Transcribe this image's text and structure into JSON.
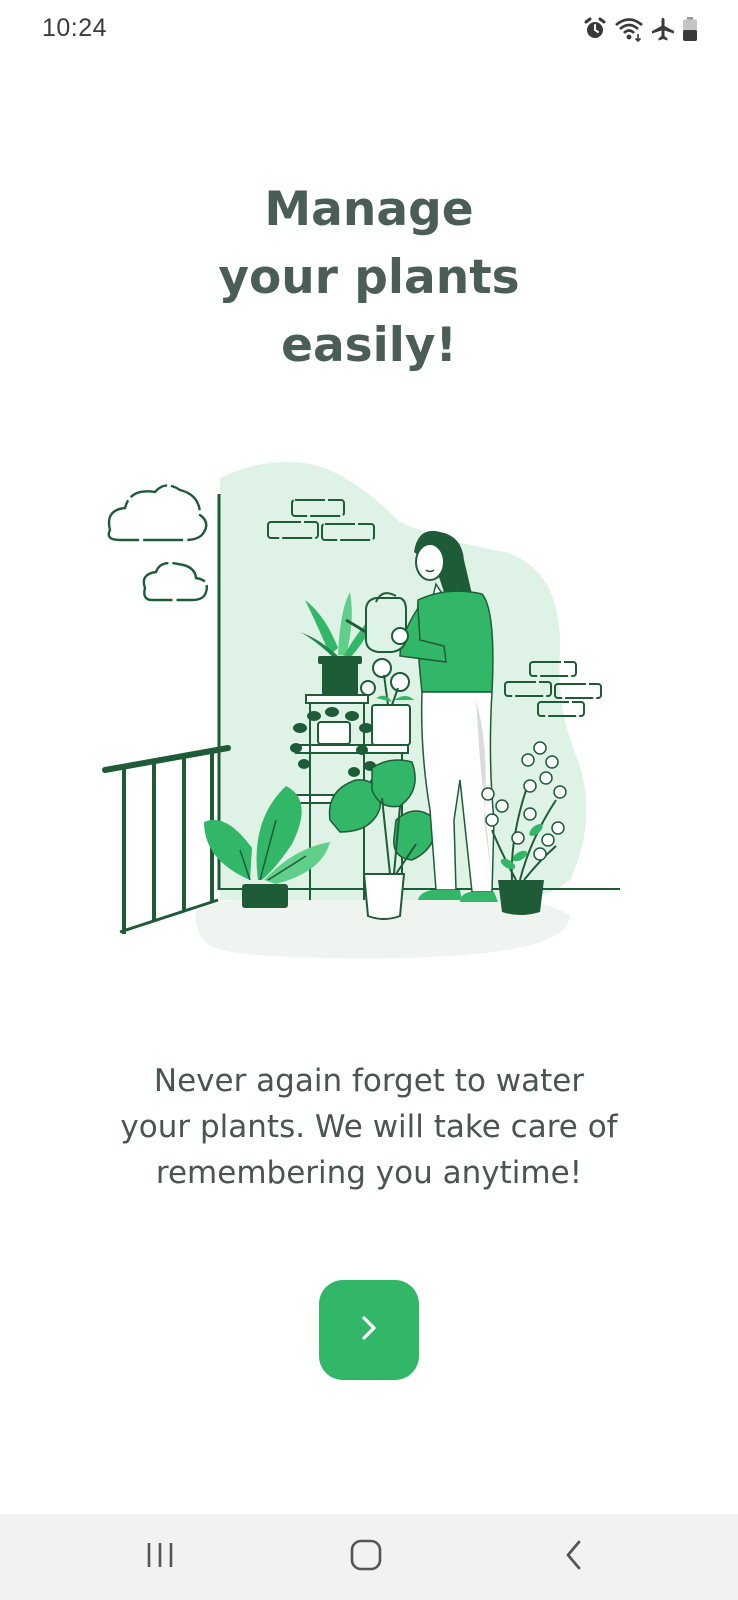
{
  "status_bar": {
    "time": "10:24",
    "icons": [
      "alarm-icon",
      "wifi-icon",
      "airplane-mode-icon",
      "battery-icon"
    ]
  },
  "onboarding": {
    "title_lines": [
      "Manage",
      "your plants",
      "easily!"
    ],
    "description_lines": [
      "Never again forget to water",
      "your plants. We will take care of",
      "remembering you anytime!"
    ],
    "next_button_icon": "chevron-right-icon",
    "illustration": "woman-watering-plants-illustration"
  },
  "nav_bar": {
    "buttons": [
      "recent-apps-icon",
      "home-icon",
      "back-icon"
    ]
  },
  "colors": {
    "accent": "#32b768",
    "title": "#4b5e55",
    "text": "#4b5550",
    "dark_green": "#1e5b37",
    "light_green": "#dff2e6",
    "nav_bg": "#f2f2f2"
  }
}
